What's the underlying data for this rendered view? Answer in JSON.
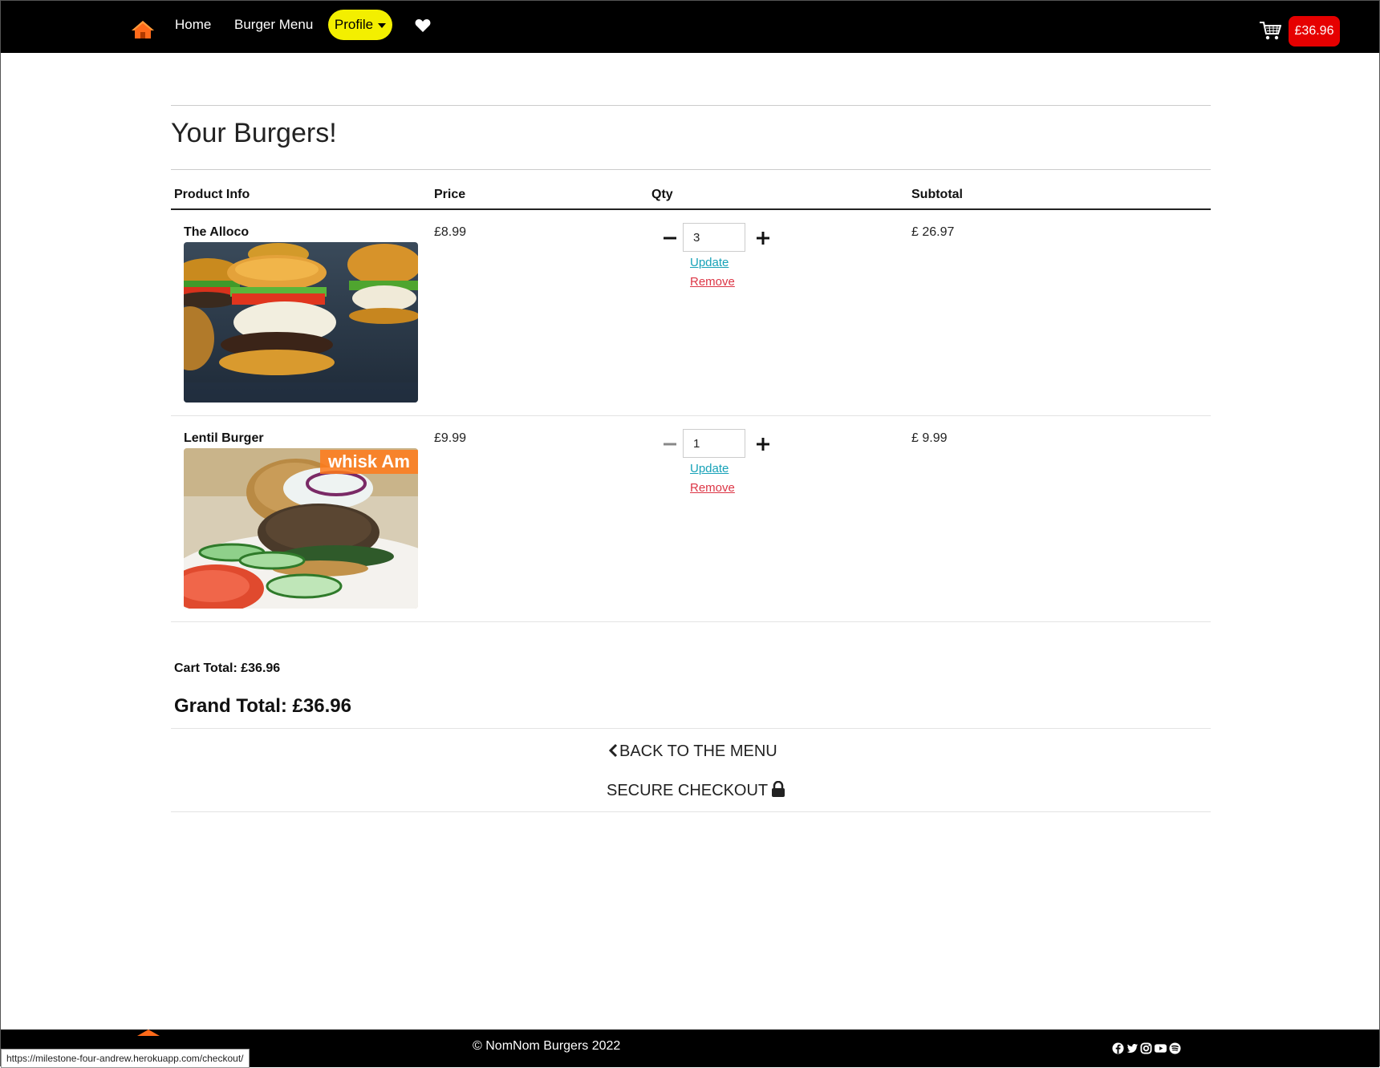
{
  "nav": {
    "home": "Home",
    "menu": "Burger Menu",
    "profile": "Profile",
    "cart_total": "£36.96"
  },
  "page": {
    "title": "Your Burgers!"
  },
  "table": {
    "headers": [
      "Product Info",
      "Price",
      "Qty",
      "Subtotal"
    ],
    "rows": [
      {
        "name": "The Alloco",
        "price": "£8.99",
        "qty": "3",
        "subtotal": "£ 26.97",
        "update": "Update",
        "remove": "Remove"
      },
      {
        "name": "Lentil Burger",
        "price": "£9.99",
        "qty": "1",
        "subtotal": "£ 9.99",
        "update": "Update",
        "remove": "Remove",
        "image_watermark": "whisk Am"
      }
    ]
  },
  "totals": {
    "cart_total": "Cart Total: £36.96",
    "grand_total": "Grand Total: £36.96"
  },
  "actions": {
    "back": "BACK TO THE MENU",
    "checkout": "SECURE CHECKOUT"
  },
  "footer": {
    "copyright": "© NomNom Burgers 2022"
  },
  "status_bar": {
    "url": "https://milestone-four-andrew.herokuapp.com/checkout/"
  },
  "colors": {
    "navbar": "#000000",
    "profile_pill": "#f3ef00",
    "cart_badge": "#e60000",
    "update_link": "#17a2b8",
    "remove_link": "#dc3545",
    "home_icon": "#ff6a1a"
  },
  "icons": [
    "home-icon",
    "caret-down-icon",
    "heart-icon",
    "shopping-cart-icon",
    "minus-icon",
    "plus-icon",
    "chevron-left-icon",
    "lock-icon",
    "facebook-icon",
    "twitter-icon",
    "instagram-icon",
    "youtube-icon",
    "spotify-icon"
  ]
}
